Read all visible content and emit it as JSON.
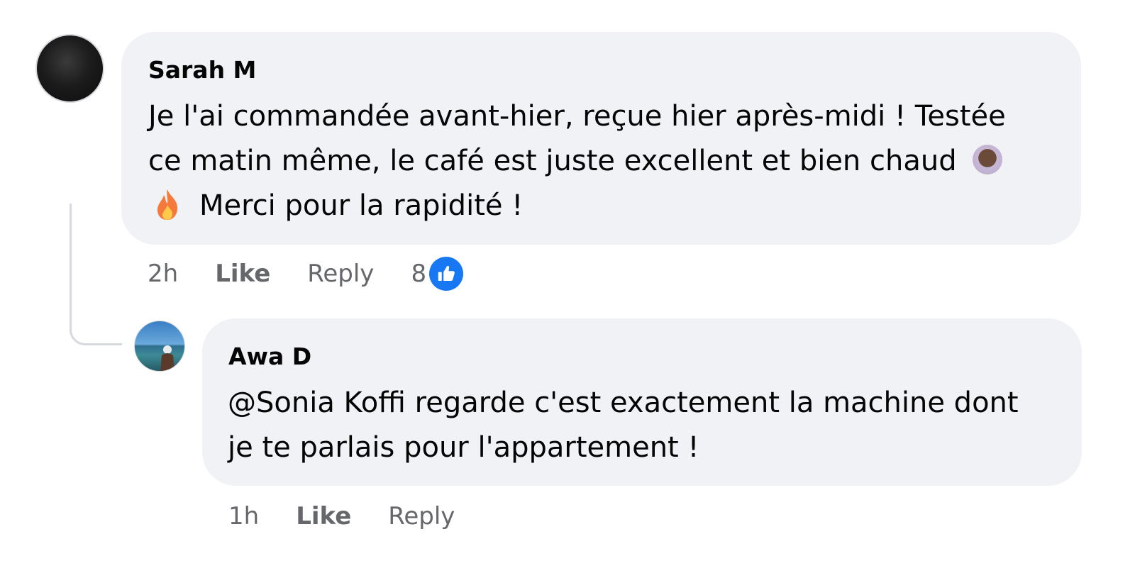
{
  "comments": [
    {
      "author": "Sarah M",
      "lines": [
        "Je l'ai commandée avant-hier, reçue hier après-midi ! Testée",
        "ce matin même, le café est juste excellent et bien chaud",
        "Merci pour la rapidité !"
      ],
      "emojis": [
        "hot-beverage",
        "fire"
      ],
      "time": "2h",
      "like_label": "Like",
      "reply_label": "Reply",
      "reaction_count": "8",
      "reaction_icon": "thumbs-up-icon",
      "reaction_color": "#1877f2"
    },
    {
      "author": "Awa D",
      "lines": [
        "@Sonia Koffi regarde c'est exactement la machine dont",
        "je te parlais pour l'appartement !"
      ],
      "time": "1h",
      "like_label": "Like",
      "reply_label": "Reply"
    }
  ],
  "colors": {
    "bubble": "#f0f2f5",
    "meta_text": "#65676b",
    "body_text": "#050505"
  }
}
